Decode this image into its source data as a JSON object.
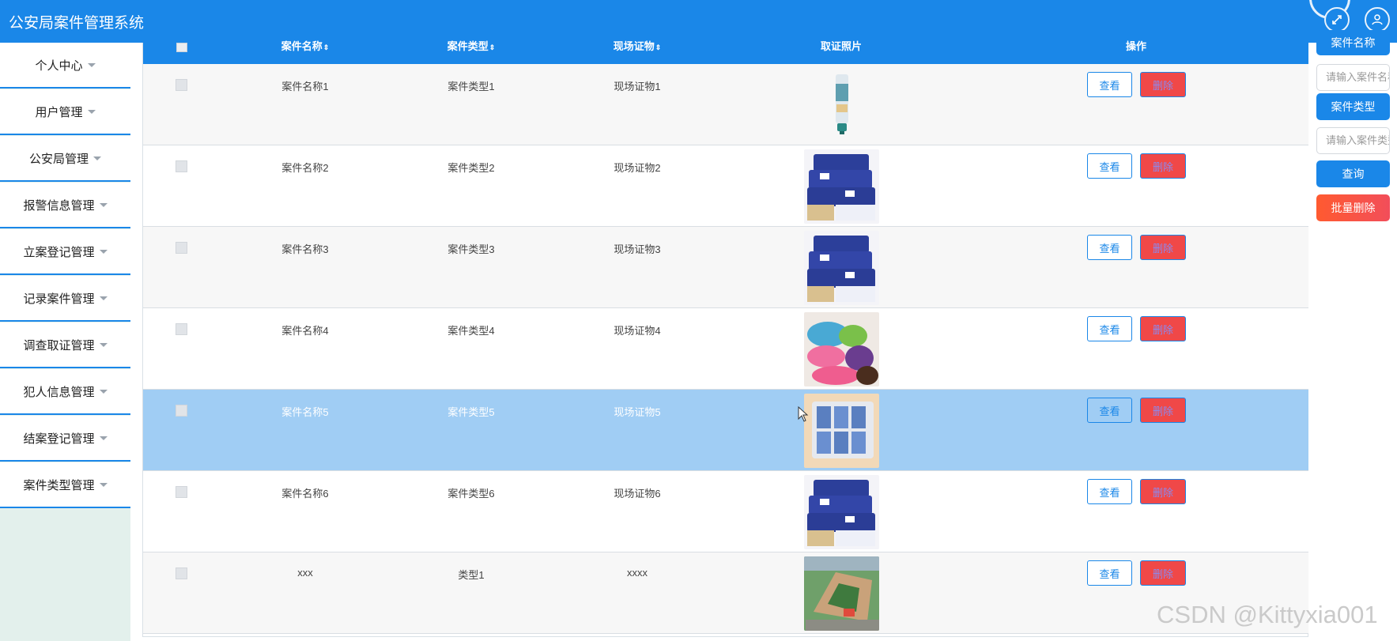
{
  "app": {
    "title": "公安局案件管理系统"
  },
  "topbar": {
    "icons": [
      "expand-icon",
      "user-icon"
    ]
  },
  "sidebar": {
    "items": [
      {
        "label": "个人中心"
      },
      {
        "label": "用户管理"
      },
      {
        "label": "公安局管理"
      },
      {
        "label": "报警信息管理"
      },
      {
        "label": "立案登记管理"
      },
      {
        "label": "记录案件管理"
      },
      {
        "label": "调查取证管理"
      },
      {
        "label": "犯人信息管理"
      },
      {
        "label": "结案登记管理"
      },
      {
        "label": "案件类型管理"
      }
    ]
  },
  "table": {
    "headers": [
      "案件名称",
      "案件类型",
      "现场证物",
      "取证照片",
      "操作"
    ],
    "sort_icon": "⇕",
    "rows": [
      {
        "name": "案件名称1",
        "type": "案件类型1",
        "evidence": "现场证物1",
        "photo": "toothpaste-tube-image",
        "view": "查看",
        "delete": "删除"
      },
      {
        "name": "案件名称2",
        "type": "案件类型2",
        "evidence": "现场证物2",
        "photo": "tissue-packs-image",
        "view": "查看",
        "delete": "删除"
      },
      {
        "name": "案件名称3",
        "type": "案件类型3",
        "evidence": "现场证物3",
        "photo": "tissue-packs-image",
        "view": "查看",
        "delete": "删除"
      },
      {
        "name": "案件名称4",
        "type": "案件类型4",
        "evidence": "现场证物4",
        "photo": "towel-rolls-image",
        "view": "查看",
        "delete": "删除"
      },
      {
        "name": "案件名称5",
        "type": "案件类型5",
        "evidence": "现场证物5",
        "photo": "tissue-box-image",
        "view": "查看",
        "delete": "删除"
      },
      {
        "name": "案件名称6",
        "type": "案件类型6",
        "evidence": "现场证物6",
        "photo": "tissue-packs-image",
        "view": "查看",
        "delete": "删除"
      },
      {
        "name": "xxx",
        "type": "类型1",
        "evidence": "xxxx",
        "photo": "building-aerial-image",
        "view": "查看",
        "delete": "删除"
      }
    ]
  },
  "search_panel": {
    "name_label": "案件名称",
    "name_placeholder": "请输入案件名称",
    "type_label": "案件类型",
    "type_placeholder": "请输入案件类型",
    "query": "查询",
    "batch_delete": "批量删除"
  },
  "watermark": "CSDN @Kittyxia001",
  "colors": {
    "primary": "#1a87e8",
    "danger": "#f04848",
    "selected_row": "#a0cdf4",
    "sidebar_bg": "#e3f0ec"
  }
}
